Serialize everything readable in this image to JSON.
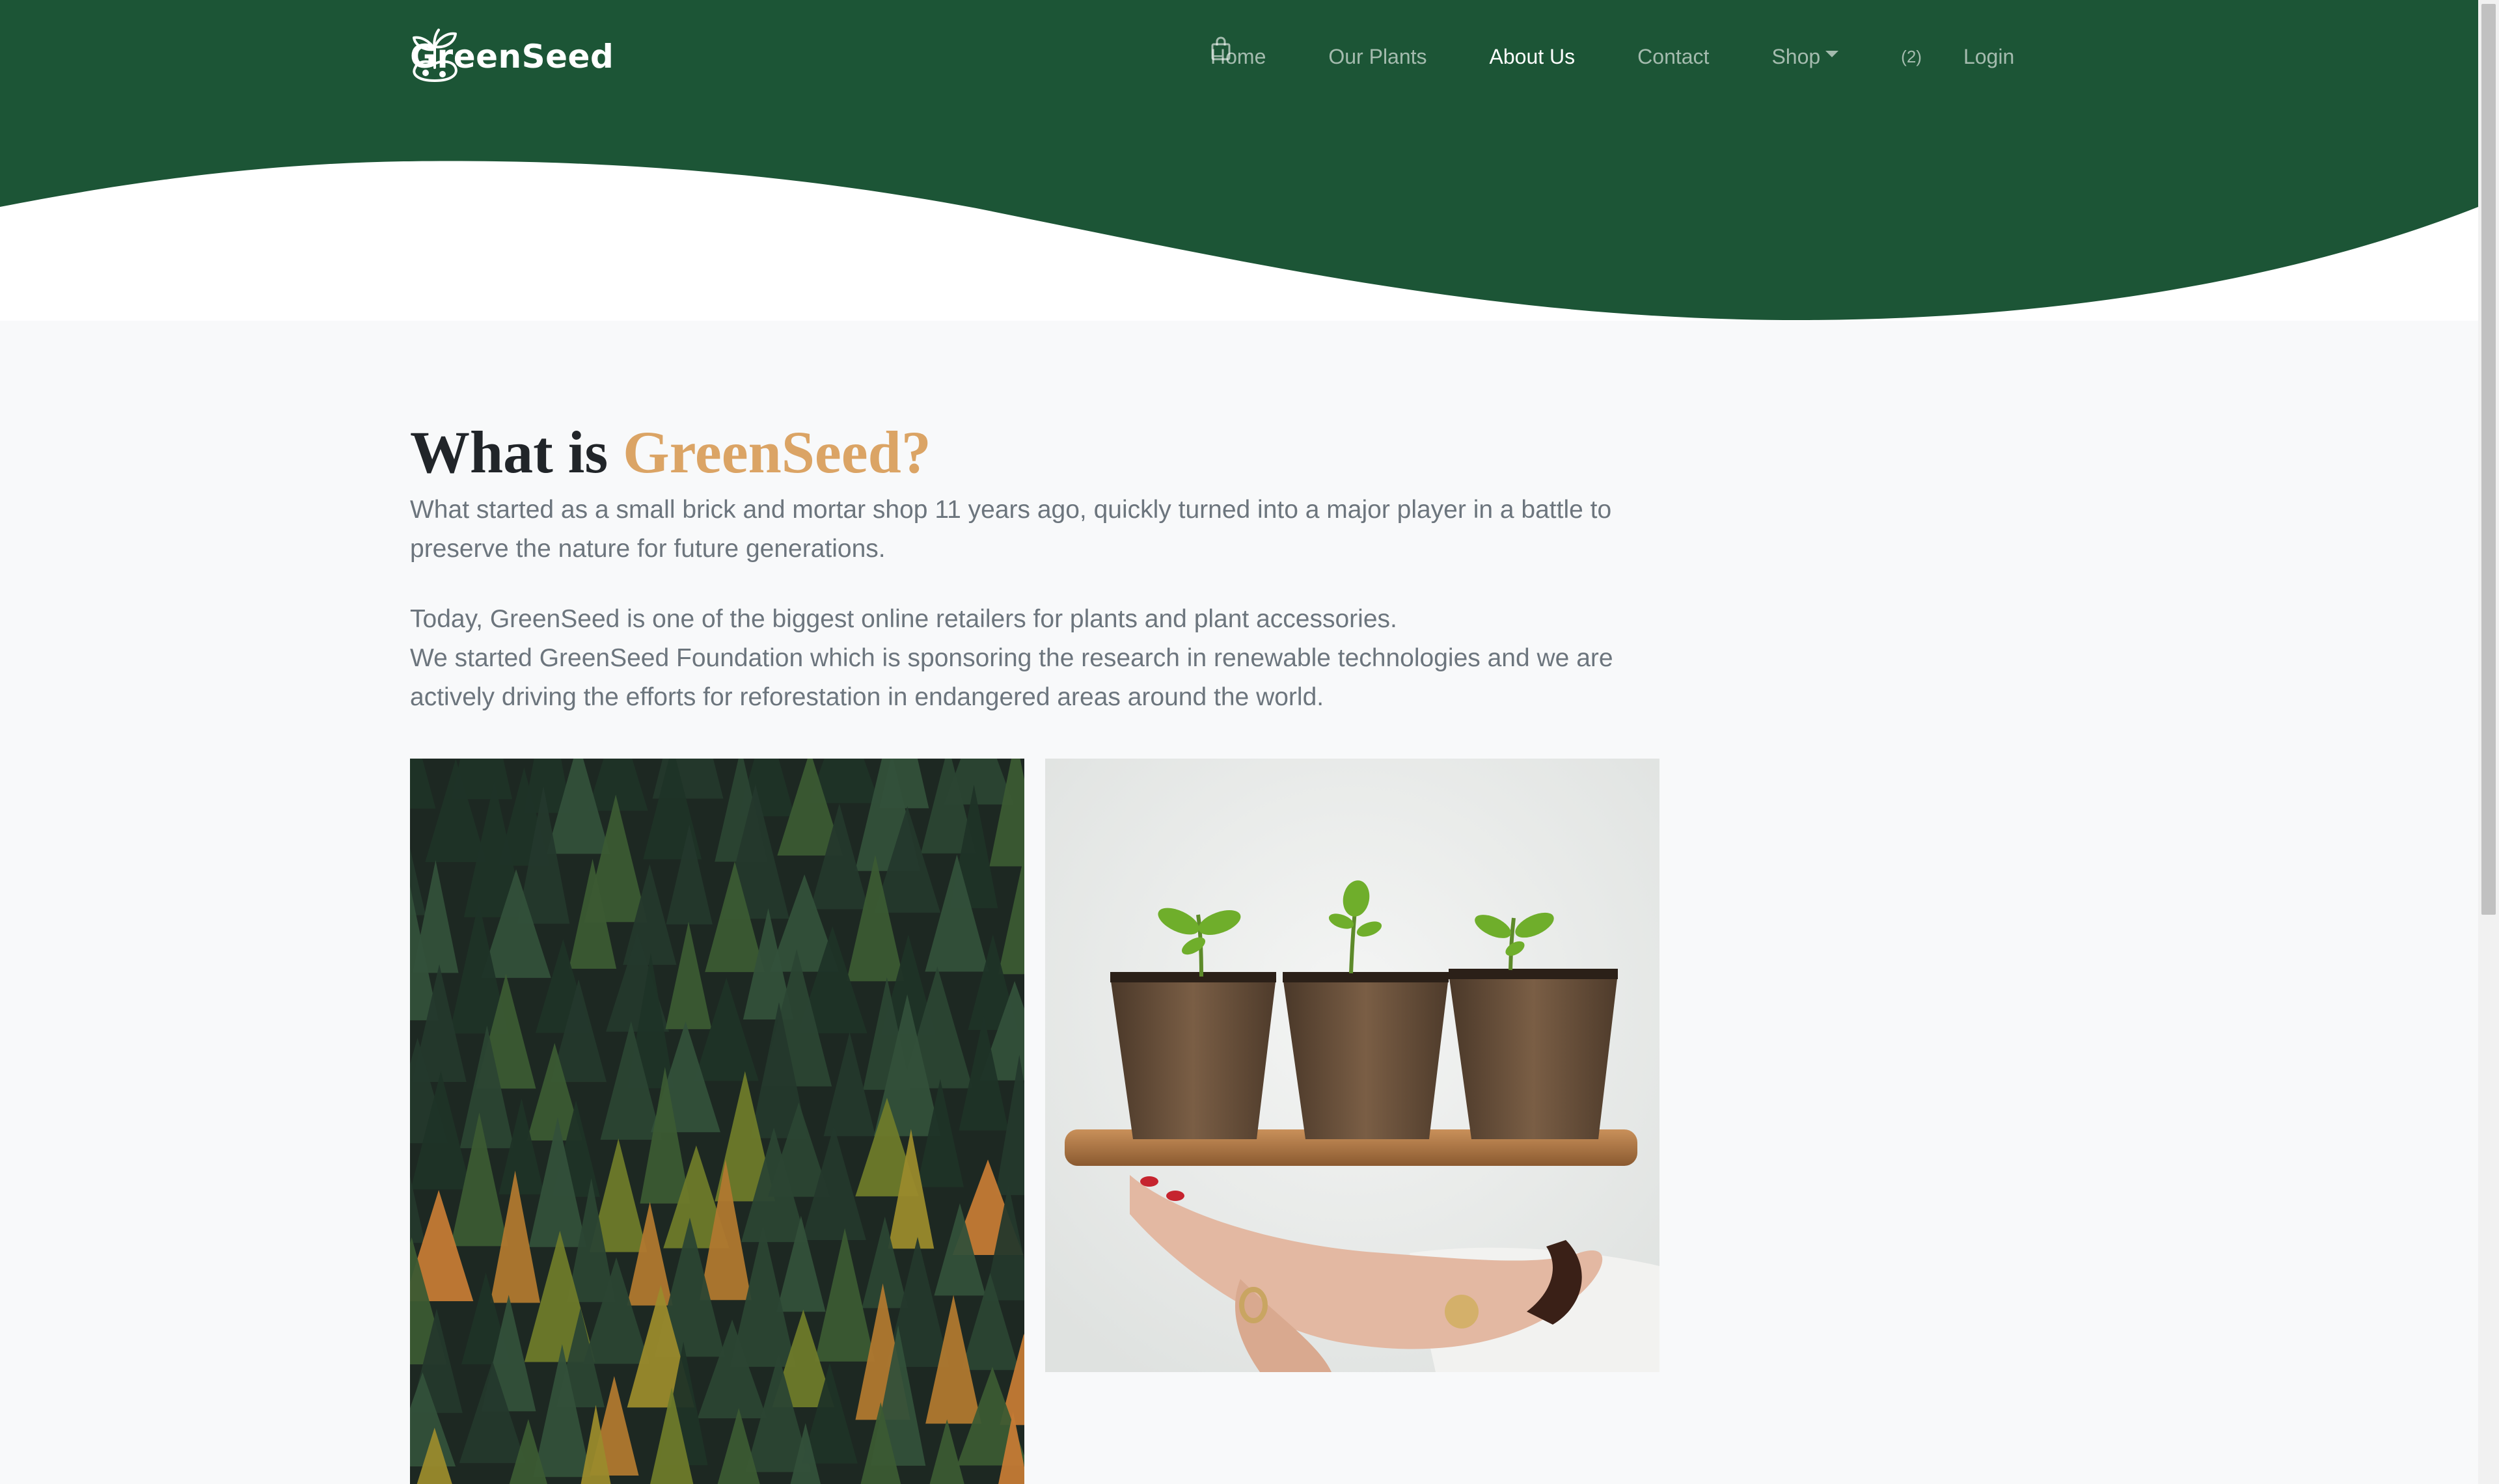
{
  "brand": {
    "name": "GreenSeed",
    "logo_icon": "seedling-logo-icon"
  },
  "nav": {
    "items": [
      {
        "label": "Home",
        "active": false
      },
      {
        "label": "Our Plants",
        "active": false
      },
      {
        "label": "About Us",
        "active": true
      },
      {
        "label": "Contact",
        "active": false
      },
      {
        "label": "Shop",
        "active": false,
        "dropdown": true
      }
    ],
    "cart": {
      "icon": "shopping-bag-icon",
      "count": "(2)"
    },
    "login": "Login"
  },
  "about": {
    "title_prefix": "What is",
    "title_accent": "GreenSeed?",
    "paragraph_1": "What started as a small brick and mortar shop 11 years ago, quickly turned into a major player in a battle to preserve the nature for future generations.",
    "paragraph_2_line_1": "Today, GreenSeed is one of the biggest online retailers for plants and plant accessories.",
    "paragraph_2_line_2": "We started GreenSeed Foundation which is sponsoring the research in renewable technologies and we are actively driving the efforts for reforestation in endangered areas around the world."
  },
  "images": [
    {
      "subject": "conifer-forest-photo"
    },
    {
      "subject": "seedlings-in-pots-photo"
    }
  ],
  "colors": {
    "header_green": "#1c5536",
    "accent_orange": "#dba465",
    "page_background": "#f8f9fa",
    "text_muted": "#6c757d",
    "heading_dark": "#212529"
  }
}
